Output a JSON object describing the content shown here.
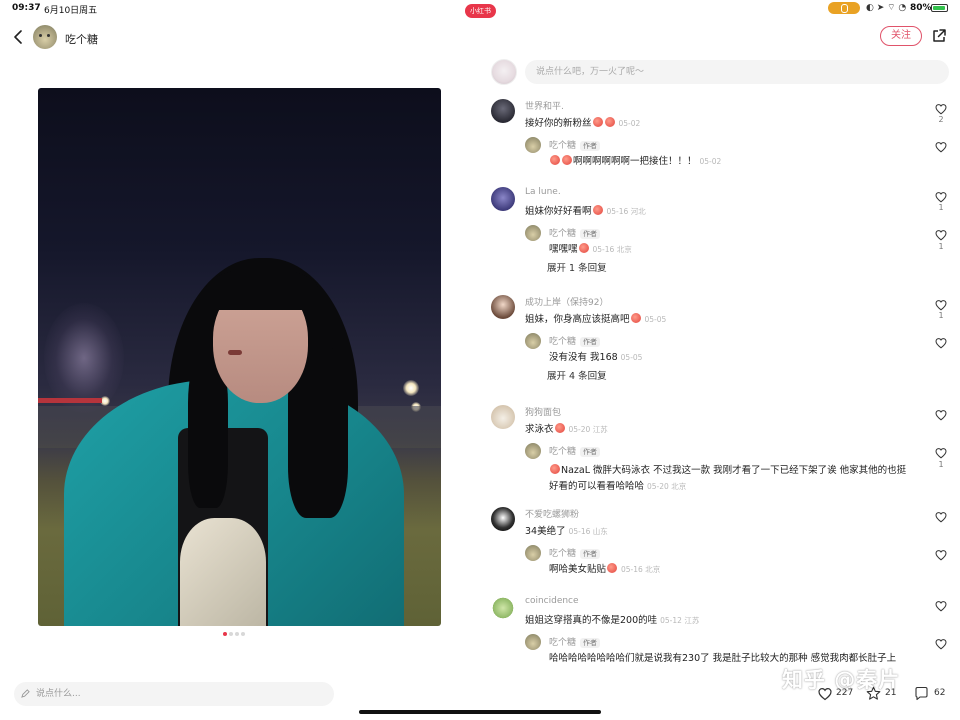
{
  "status_bar": {
    "time": "09:37",
    "date": "6月10日周五",
    "badge": "小红书",
    "battery": "80%"
  },
  "header": {
    "author_name": "吃个糖",
    "follow_label": "关注"
  },
  "photo": {
    "pages": 4,
    "current_page": 1
  },
  "comment_input": {
    "placeholder": "说点什么吧，万一火了呢～"
  },
  "comments": [
    {
      "user": "世界和平.",
      "text": "接好你的新粉丝",
      "meta": "05-02",
      "likes": "2",
      "reply": {
        "user": "吃个糖",
        "tag": "作者",
        "text": "啊啊啊啊啊啊一把接住！！！",
        "meta": "05-02",
        "likes": ""
      }
    },
    {
      "user": "La lune.",
      "text": "姐妹你好好看啊",
      "meta": "05-16 河北",
      "likes": "1",
      "reply": {
        "user": "吃个糖",
        "tag": "作者",
        "text": "嘿嘿嘿",
        "meta": "05-16 北京",
        "likes": "1"
      },
      "expand": "展开 1 条回复"
    },
    {
      "user": "成功上岸（保持92）",
      "text": "姐妹，你身高应该挺高吧",
      "meta": "05-05",
      "likes": "1",
      "reply": {
        "user": "吃个糖",
        "tag": "作者",
        "text": "没有没有 我168",
        "meta": "05-05",
        "likes": ""
      },
      "expand": "展开 4 条回复"
    },
    {
      "user": "狗狗面包",
      "text": "求泳衣",
      "meta": "05-20 江苏",
      "likes": "",
      "reply": {
        "user": "吃个糖",
        "tag": "作者",
        "text": "NazaL 微胖大码泳衣 不过我这一款 我刚才看了一下已经下架了诶 他家其他的也挺",
        "text2": "好看的可以看看哈哈哈",
        "meta": "05-20 北京",
        "likes": "1"
      }
    },
    {
      "user": "不爱吃螺狮粉",
      "text": "34美绝了",
      "meta": "05-16 山东",
      "likes": "",
      "reply": {
        "user": "吃个糖",
        "tag": "作者",
        "text": "啊哈美女贴贴",
        "meta": "05-16 北京",
        "likes": ""
      }
    },
    {
      "user": "coincidence",
      "text": "姐姐这穿搭真的不像是200的哇",
      "meta": "05-12 江苏",
      "likes": "",
      "reply": {
        "user": "吃个糖",
        "tag": "作者",
        "text": "哈哈哈哈哈哈哈哈们就是说我有230了 我是肚子比较大的那种 感觉我肉都长肚子上",
        "meta": "",
        "likes": ""
      }
    }
  ],
  "bottom_bar": {
    "placeholder": "说点什么...",
    "likes": "227",
    "stars": "21",
    "comments": "62"
  },
  "watermark": "知乎 @秦片",
  "colors": {
    "accent": "#e0536a",
    "badge": "#e8364a",
    "mic": "#e9a224"
  }
}
